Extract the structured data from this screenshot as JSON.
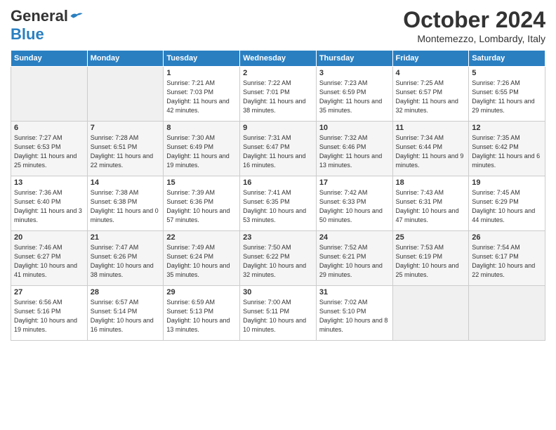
{
  "logo": {
    "general": "General",
    "blue": "Blue"
  },
  "title": "October 2024",
  "subtitle": "Montemezzo, Lombardy, Italy",
  "days_header": [
    "Sunday",
    "Monday",
    "Tuesday",
    "Wednesday",
    "Thursday",
    "Friday",
    "Saturday"
  ],
  "weeks": [
    [
      {
        "num": "",
        "sunrise": "",
        "sunset": "",
        "daylight": ""
      },
      {
        "num": "",
        "sunrise": "",
        "sunset": "",
        "daylight": ""
      },
      {
        "num": "1",
        "sunrise": "Sunrise: 7:21 AM",
        "sunset": "Sunset: 7:03 PM",
        "daylight": "Daylight: 11 hours and 42 minutes."
      },
      {
        "num": "2",
        "sunrise": "Sunrise: 7:22 AM",
        "sunset": "Sunset: 7:01 PM",
        "daylight": "Daylight: 11 hours and 38 minutes."
      },
      {
        "num": "3",
        "sunrise": "Sunrise: 7:23 AM",
        "sunset": "Sunset: 6:59 PM",
        "daylight": "Daylight: 11 hours and 35 minutes."
      },
      {
        "num": "4",
        "sunrise": "Sunrise: 7:25 AM",
        "sunset": "Sunset: 6:57 PM",
        "daylight": "Daylight: 11 hours and 32 minutes."
      },
      {
        "num": "5",
        "sunrise": "Sunrise: 7:26 AM",
        "sunset": "Sunset: 6:55 PM",
        "daylight": "Daylight: 11 hours and 29 minutes."
      }
    ],
    [
      {
        "num": "6",
        "sunrise": "Sunrise: 7:27 AM",
        "sunset": "Sunset: 6:53 PM",
        "daylight": "Daylight: 11 hours and 25 minutes."
      },
      {
        "num": "7",
        "sunrise": "Sunrise: 7:28 AM",
        "sunset": "Sunset: 6:51 PM",
        "daylight": "Daylight: 11 hours and 22 minutes."
      },
      {
        "num": "8",
        "sunrise": "Sunrise: 7:30 AM",
        "sunset": "Sunset: 6:49 PM",
        "daylight": "Daylight: 11 hours and 19 minutes."
      },
      {
        "num": "9",
        "sunrise": "Sunrise: 7:31 AM",
        "sunset": "Sunset: 6:47 PM",
        "daylight": "Daylight: 11 hours and 16 minutes."
      },
      {
        "num": "10",
        "sunrise": "Sunrise: 7:32 AM",
        "sunset": "Sunset: 6:46 PM",
        "daylight": "Daylight: 11 hours and 13 minutes."
      },
      {
        "num": "11",
        "sunrise": "Sunrise: 7:34 AM",
        "sunset": "Sunset: 6:44 PM",
        "daylight": "Daylight: 11 hours and 9 minutes."
      },
      {
        "num": "12",
        "sunrise": "Sunrise: 7:35 AM",
        "sunset": "Sunset: 6:42 PM",
        "daylight": "Daylight: 11 hours and 6 minutes."
      }
    ],
    [
      {
        "num": "13",
        "sunrise": "Sunrise: 7:36 AM",
        "sunset": "Sunset: 6:40 PM",
        "daylight": "Daylight: 11 hours and 3 minutes."
      },
      {
        "num": "14",
        "sunrise": "Sunrise: 7:38 AM",
        "sunset": "Sunset: 6:38 PM",
        "daylight": "Daylight: 11 hours and 0 minutes."
      },
      {
        "num": "15",
        "sunrise": "Sunrise: 7:39 AM",
        "sunset": "Sunset: 6:36 PM",
        "daylight": "Daylight: 10 hours and 57 minutes."
      },
      {
        "num": "16",
        "sunrise": "Sunrise: 7:41 AM",
        "sunset": "Sunset: 6:35 PM",
        "daylight": "Daylight: 10 hours and 53 minutes."
      },
      {
        "num": "17",
        "sunrise": "Sunrise: 7:42 AM",
        "sunset": "Sunset: 6:33 PM",
        "daylight": "Daylight: 10 hours and 50 minutes."
      },
      {
        "num": "18",
        "sunrise": "Sunrise: 7:43 AM",
        "sunset": "Sunset: 6:31 PM",
        "daylight": "Daylight: 10 hours and 47 minutes."
      },
      {
        "num": "19",
        "sunrise": "Sunrise: 7:45 AM",
        "sunset": "Sunset: 6:29 PM",
        "daylight": "Daylight: 10 hours and 44 minutes."
      }
    ],
    [
      {
        "num": "20",
        "sunrise": "Sunrise: 7:46 AM",
        "sunset": "Sunset: 6:27 PM",
        "daylight": "Daylight: 10 hours and 41 minutes."
      },
      {
        "num": "21",
        "sunrise": "Sunrise: 7:47 AM",
        "sunset": "Sunset: 6:26 PM",
        "daylight": "Daylight: 10 hours and 38 minutes."
      },
      {
        "num": "22",
        "sunrise": "Sunrise: 7:49 AM",
        "sunset": "Sunset: 6:24 PM",
        "daylight": "Daylight: 10 hours and 35 minutes."
      },
      {
        "num": "23",
        "sunrise": "Sunrise: 7:50 AM",
        "sunset": "Sunset: 6:22 PM",
        "daylight": "Daylight: 10 hours and 32 minutes."
      },
      {
        "num": "24",
        "sunrise": "Sunrise: 7:52 AM",
        "sunset": "Sunset: 6:21 PM",
        "daylight": "Daylight: 10 hours and 29 minutes."
      },
      {
        "num": "25",
        "sunrise": "Sunrise: 7:53 AM",
        "sunset": "Sunset: 6:19 PM",
        "daylight": "Daylight: 10 hours and 25 minutes."
      },
      {
        "num": "26",
        "sunrise": "Sunrise: 7:54 AM",
        "sunset": "Sunset: 6:17 PM",
        "daylight": "Daylight: 10 hours and 22 minutes."
      }
    ],
    [
      {
        "num": "27",
        "sunrise": "Sunrise: 6:56 AM",
        "sunset": "Sunset: 5:16 PM",
        "daylight": "Daylight: 10 hours and 19 minutes."
      },
      {
        "num": "28",
        "sunrise": "Sunrise: 6:57 AM",
        "sunset": "Sunset: 5:14 PM",
        "daylight": "Daylight: 10 hours and 16 minutes."
      },
      {
        "num": "29",
        "sunrise": "Sunrise: 6:59 AM",
        "sunset": "Sunset: 5:13 PM",
        "daylight": "Daylight: 10 hours and 13 minutes."
      },
      {
        "num": "30",
        "sunrise": "Sunrise: 7:00 AM",
        "sunset": "Sunset: 5:11 PM",
        "daylight": "Daylight: 10 hours and 10 minutes."
      },
      {
        "num": "31",
        "sunrise": "Sunrise: 7:02 AM",
        "sunset": "Sunset: 5:10 PM",
        "daylight": "Daylight: 10 hours and 8 minutes."
      },
      {
        "num": "",
        "sunrise": "",
        "sunset": "",
        "daylight": ""
      },
      {
        "num": "",
        "sunrise": "",
        "sunset": "",
        "daylight": ""
      }
    ]
  ]
}
